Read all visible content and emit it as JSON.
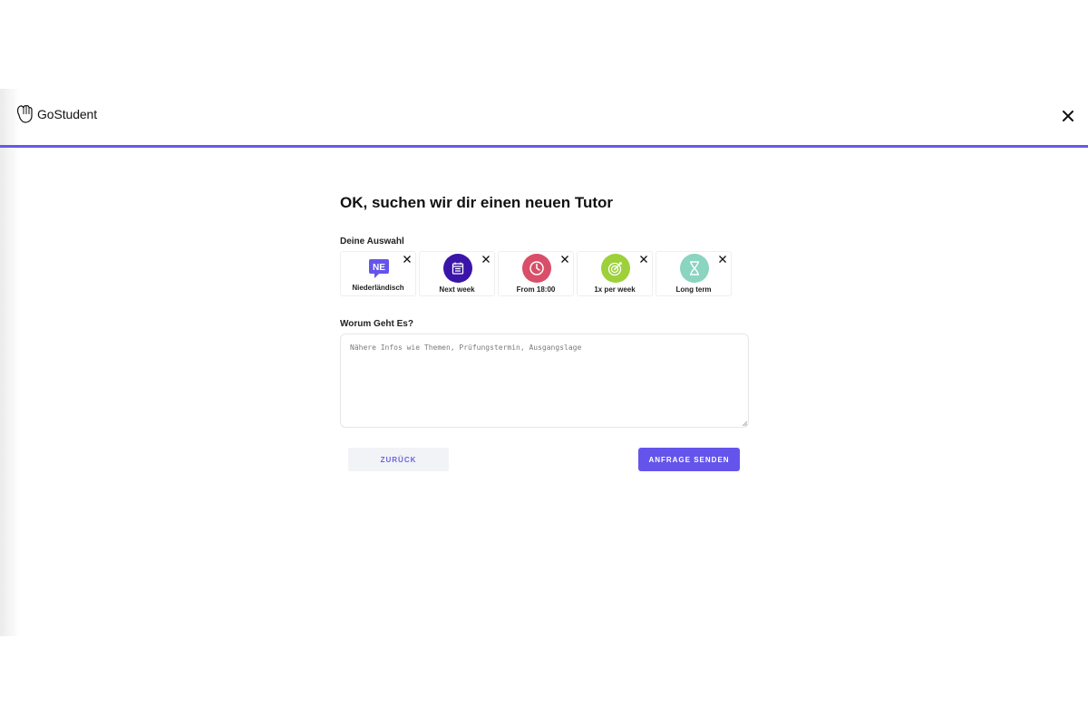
{
  "brand": {
    "name": "GoStudent"
  },
  "colors": {
    "accent": "#6554eb",
    "progress": "#6859e8",
    "chip_next_week": "#3a15a8",
    "chip_from": "#d94e68",
    "chip_per_week": "#9ed03c",
    "chip_long_term": "#8ad4c0",
    "lang_badge": "#6554eb"
  },
  "header": {
    "close_icon": "close-icon"
  },
  "main": {
    "title": "OK, suchen wir dir einen neuen Tutor",
    "selection_label": "Deine Auswahl",
    "selections": [
      {
        "label": "Niederländisch",
        "badge": "NE",
        "icon": "language-badge-icon"
      },
      {
        "label": "Next week",
        "icon": "calendar-icon"
      },
      {
        "label": "From 18:00",
        "icon": "clock-icon"
      },
      {
        "label": "1x per week",
        "icon": "target-icon"
      },
      {
        "label": "Long term",
        "icon": "hourglass-icon"
      }
    ],
    "about_label": "Worum Geht Es?",
    "about_placeholder": "Nähere Infos wie Themen, Prüfungstermin, Ausgangslage",
    "about_value": "",
    "back_button": "ZURÜCK",
    "send_button": "ANFRAGE SENDEN"
  }
}
